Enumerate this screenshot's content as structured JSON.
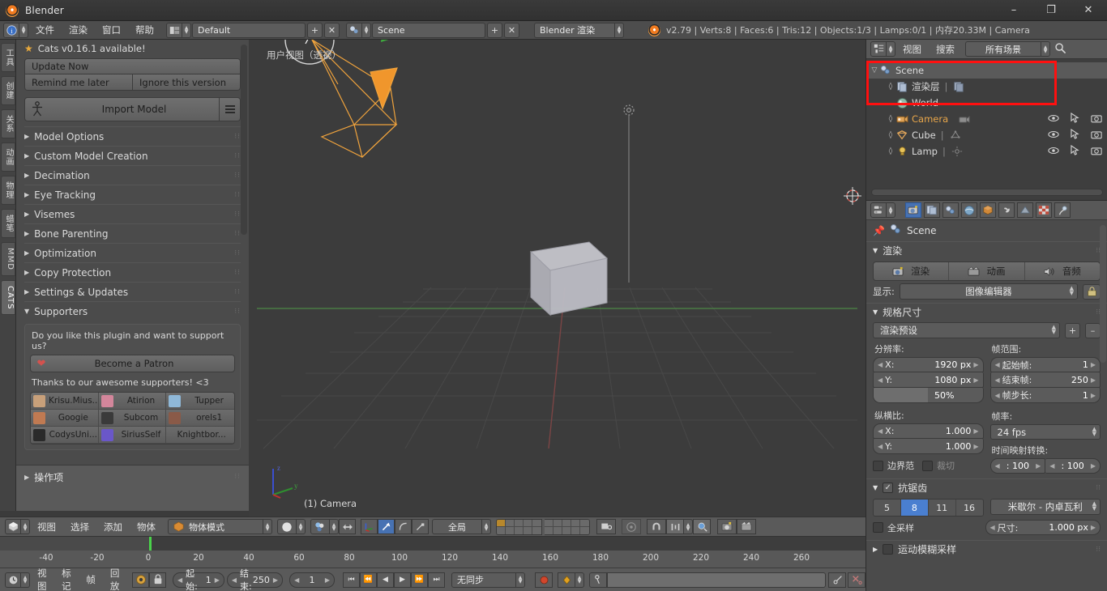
{
  "window": {
    "title": "Blender",
    "minimize": "–",
    "maximize": "❐",
    "close": "✕"
  },
  "top_header": {
    "menus": [
      "文件",
      "渲染",
      "窗口",
      "帮助"
    ],
    "screen_layout": "Default",
    "scene_name": "Scene",
    "render_engine": "Blender 渲染",
    "add_label": "+",
    "remove_label": "✕",
    "stats": "v2.79 | Verts:8 | Faces:6 | Tris:12 | Objects:1/3 | Lamps:0/1 | 内存20.33M | Camera"
  },
  "vertical_tabs": [
    {
      "label": "工具",
      "active": false
    },
    {
      "label": "创建",
      "active": false
    },
    {
      "label": "关系",
      "active": false
    },
    {
      "label": "动画",
      "active": false
    },
    {
      "label": "物理",
      "active": false
    },
    {
      "label": "蜡笔",
      "active": false
    },
    {
      "label": "MMD",
      "active": false
    },
    {
      "label": "CATS",
      "active": true
    }
  ],
  "cats_panel": {
    "notice": "Cats v0.16.1 available!",
    "update_now": "Update Now",
    "remind_me_later": "Remind me later",
    "ignore_this_version": "Ignore this version",
    "import_model": "Import Model",
    "sections": [
      "Model Options",
      "Custom Model Creation",
      "Decimation",
      "Eye Tracking",
      "Visemes",
      "Bone Parenting",
      "Optimization",
      "Copy Protection",
      "Settings & Updates"
    ],
    "supporters_section": "Supporters",
    "support_question": "Do you like this plugin and want to support us?",
    "become_patron": "Become a Patron",
    "thanks": "Thanks to our awesome supporters! <3",
    "supporters": [
      {
        "name": "Krisu.Mius...",
        "color": "#c8a07a"
      },
      {
        "name": "Atirion",
        "color": "#d3869b"
      },
      {
        "name": "Tupper",
        "color": "#8fb8d8"
      },
      {
        "name": "Googie",
        "color": "#c07a52"
      },
      {
        "name": "Subcom",
        "color": "#3a3a3a"
      },
      {
        "name": "orels1",
        "color": "#8a5a48"
      },
      {
        "name": "CodysUni...",
        "color": "#2a2a2a"
      },
      {
        "name": "SiriusSelf",
        "color": "#6a57c8"
      },
      {
        "name": "Knightbor...",
        "color": "#6d6d6d"
      }
    ]
  },
  "operator_panel": {
    "title": "操作项"
  },
  "viewport": {
    "view_label": "用户视图（透视）",
    "object_label": "(1) Camera",
    "axis_x": "x",
    "axis_y": "y",
    "axis_z": "z"
  },
  "viewport_header": {
    "menus": [
      "视图",
      "选择",
      "添加",
      "物体"
    ],
    "interaction_mode": "物体模式",
    "transform_orientation": "全局"
  },
  "timeline": {
    "menus": [
      "视图",
      "标记",
      "帧",
      "回放"
    ],
    "start_label": "起始:",
    "start_value": "1",
    "end_label": "结束:",
    "end_value": "250",
    "current_frame": "1",
    "sync_mode": "无同步",
    "ticks": [
      "-40",
      "-20",
      "0",
      "20",
      "40",
      "60",
      "80",
      "100",
      "120",
      "140",
      "160",
      "180",
      "200",
      "220",
      "240",
      "260"
    ],
    "playhead_frame": "0"
  },
  "outliner": {
    "header": {
      "view_menu": "视图",
      "search_menu": "搜索",
      "display_mode": "所有场景"
    },
    "rows": [
      {
        "label": "Scene",
        "indent": 0,
        "icon": "scene-icon",
        "expanded": true,
        "selected": true,
        "restrict": false
      },
      {
        "label": "渲染层",
        "indent": 1,
        "icon": "renderlayer-icon",
        "expanded": false,
        "selected": false,
        "restrict": false
      },
      {
        "label": "World",
        "indent": 1,
        "icon": "world-icon",
        "expanded": null,
        "selected": false,
        "restrict": false
      },
      {
        "label": "Camera",
        "indent": 1,
        "icon": "camera-icon",
        "expanded": false,
        "selected": false,
        "restrict": true
      },
      {
        "label": "Cube",
        "indent": 1,
        "icon": "mesh-icon",
        "expanded": false,
        "selected": false,
        "restrict": true
      },
      {
        "label": "Lamp",
        "indent": 1,
        "icon": "lamp-icon",
        "expanded": false,
        "selected": false,
        "restrict": true
      }
    ],
    "annotation_color": "#ff1010"
  },
  "properties": {
    "breadcrumb": "Scene",
    "render_section": "渲染",
    "render_button": "渲染",
    "animation_button": "动画",
    "audio_button": "音频",
    "display_label": "显示:",
    "display_value": "图像编辑器",
    "dimensions_section": "规格尺寸",
    "preset_value": "渲染预设",
    "preset_add": "+",
    "preset_remove": "–",
    "resolution_label": "分辨率:",
    "resolution_x_label": "X:",
    "resolution_x_value": "1920 px",
    "resolution_y_label": "Y:",
    "resolution_y_value": "1080 px",
    "resolution_percent": "50%",
    "aspect_label": "纵横比:",
    "aspect_x_label": "X:",
    "aspect_x_value": "1.000",
    "aspect_y_label": "Y:",
    "aspect_y_value": "1.000",
    "border_label": "边界范",
    "crop_label": "裁切",
    "frame_range_label": "帧范围:",
    "frame_start_label": "起始帧:",
    "frame_start_value": "1",
    "frame_end_label": "结束帧:",
    "frame_end_value": "250",
    "frame_step_label": "帧步长:",
    "frame_step_value": "1",
    "frame_rate_label": "帧率:",
    "frame_rate_value": "24 fps",
    "time_remapping_label": "时间映射转换:",
    "time_remap_old": ": 100",
    "time_remap_new": ": 100",
    "aa_section": "抗锯齿",
    "aa_options": [
      "5",
      "8",
      "11",
      "16"
    ],
    "aa_active": "8",
    "aa_filter": "米歇尔 - 内卓瓦利",
    "full_sample_label": "全采样",
    "size_label": "尺寸:",
    "size_value": "1.000 px",
    "motion_blur_section": "运动模糊采样"
  }
}
